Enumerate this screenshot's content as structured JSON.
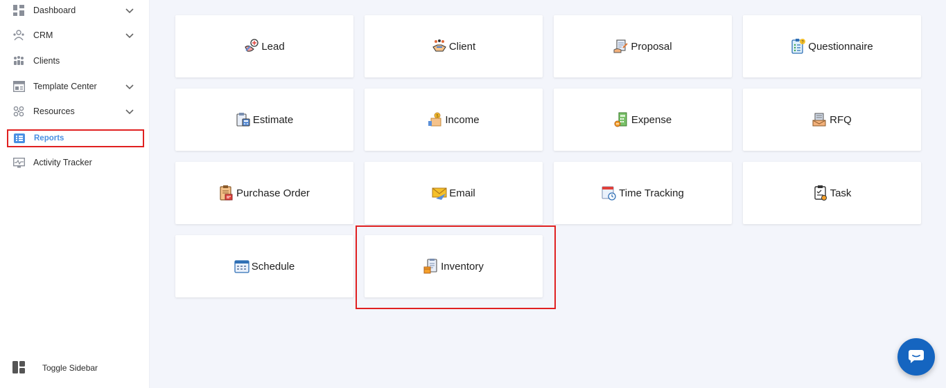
{
  "sidebar": {
    "items": [
      {
        "label": "Dashboard",
        "icon": "grid-icon",
        "has_chevron": true
      },
      {
        "label": "CRM",
        "icon": "crm-icon",
        "has_chevron": true
      },
      {
        "label": "Clients",
        "icon": "users-icon",
        "has_chevron": false
      },
      {
        "label": "Template Center",
        "icon": "template-icon",
        "has_chevron": true
      },
      {
        "label": "Resources",
        "icon": "resources-icon",
        "has_chevron": true
      },
      {
        "label": "Reports",
        "icon": "reports-icon",
        "has_chevron": false,
        "active": true
      },
      {
        "label": "Activity Tracker",
        "icon": "activity-icon",
        "has_chevron": false
      }
    ],
    "toggle_label": "Toggle Sidebar"
  },
  "cards": [
    {
      "label": "Lead",
      "icon": "lead-icon"
    },
    {
      "label": "Client",
      "icon": "client-icon"
    },
    {
      "label": "Proposal",
      "icon": "proposal-icon"
    },
    {
      "label": "Questionnaire",
      "icon": "questionnaire-icon"
    },
    {
      "label": "Estimate",
      "icon": "estimate-icon"
    },
    {
      "label": "Income",
      "icon": "income-icon"
    },
    {
      "label": "Expense",
      "icon": "expense-icon"
    },
    {
      "label": "RFQ",
      "icon": "rfq-icon"
    },
    {
      "label": "Purchase Order",
      "icon": "purchase-order-icon"
    },
    {
      "label": "Email",
      "icon": "email-icon"
    },
    {
      "label": "Time Tracking",
      "icon": "time-tracking-icon"
    },
    {
      "label": "Task",
      "icon": "task-icon"
    },
    {
      "label": "Schedule",
      "icon": "schedule-icon"
    },
    {
      "label": "Inventory",
      "icon": "inventory-icon"
    }
  ],
  "colors": {
    "accent": "#4a90e2",
    "highlight": "#e02020",
    "chat": "#1565c0",
    "background": "#f3f5fb"
  }
}
